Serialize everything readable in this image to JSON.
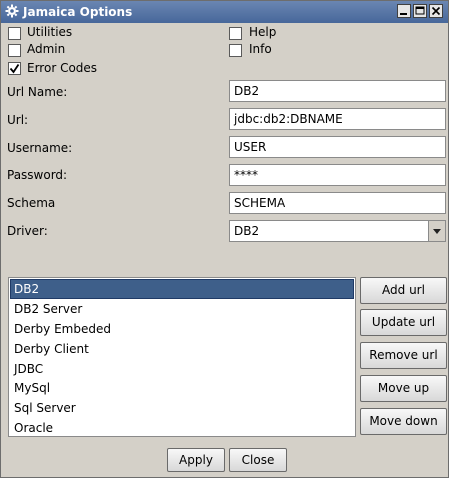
{
  "window": {
    "title": "Jamaica Options"
  },
  "checkboxes": {
    "utilities": {
      "label": "Utilities",
      "checked": false
    },
    "help": {
      "label": "Help",
      "checked": false
    },
    "admin": {
      "label": "Admin",
      "checked": false
    },
    "info": {
      "label": "Info",
      "checked": false
    },
    "error_codes": {
      "label": "Error Codes",
      "checked": true
    }
  },
  "fields": {
    "url_name": {
      "label": "Url Name:",
      "value": "DB2"
    },
    "url": {
      "label": "Url:",
      "value": "jdbc:db2:DBNAME"
    },
    "username": {
      "label": "Username:",
      "value": "USER"
    },
    "password": {
      "label": "Password:",
      "value": "****"
    },
    "schema": {
      "label": "Schema",
      "value": "SCHEMA"
    },
    "driver": {
      "label": "Driver:",
      "value": "DB2"
    }
  },
  "url_list": {
    "items": [
      "DB2",
      "DB2 Server",
      "Derby Embeded",
      "Derby Client",
      "JDBC",
      "MySql",
      "Sql Server",
      "Oracle"
    ],
    "selected": "DB2"
  },
  "buttons": {
    "add_url": "Add url",
    "update_url": "Update url",
    "remove_url": "Remove url",
    "move_up": "Move up",
    "move_down": "Move down",
    "apply": "Apply",
    "close": "Close"
  },
  "colors": {
    "titlebar": "#47679a",
    "selection": "#3e5f8a",
    "panel": "#d4d0c8"
  }
}
